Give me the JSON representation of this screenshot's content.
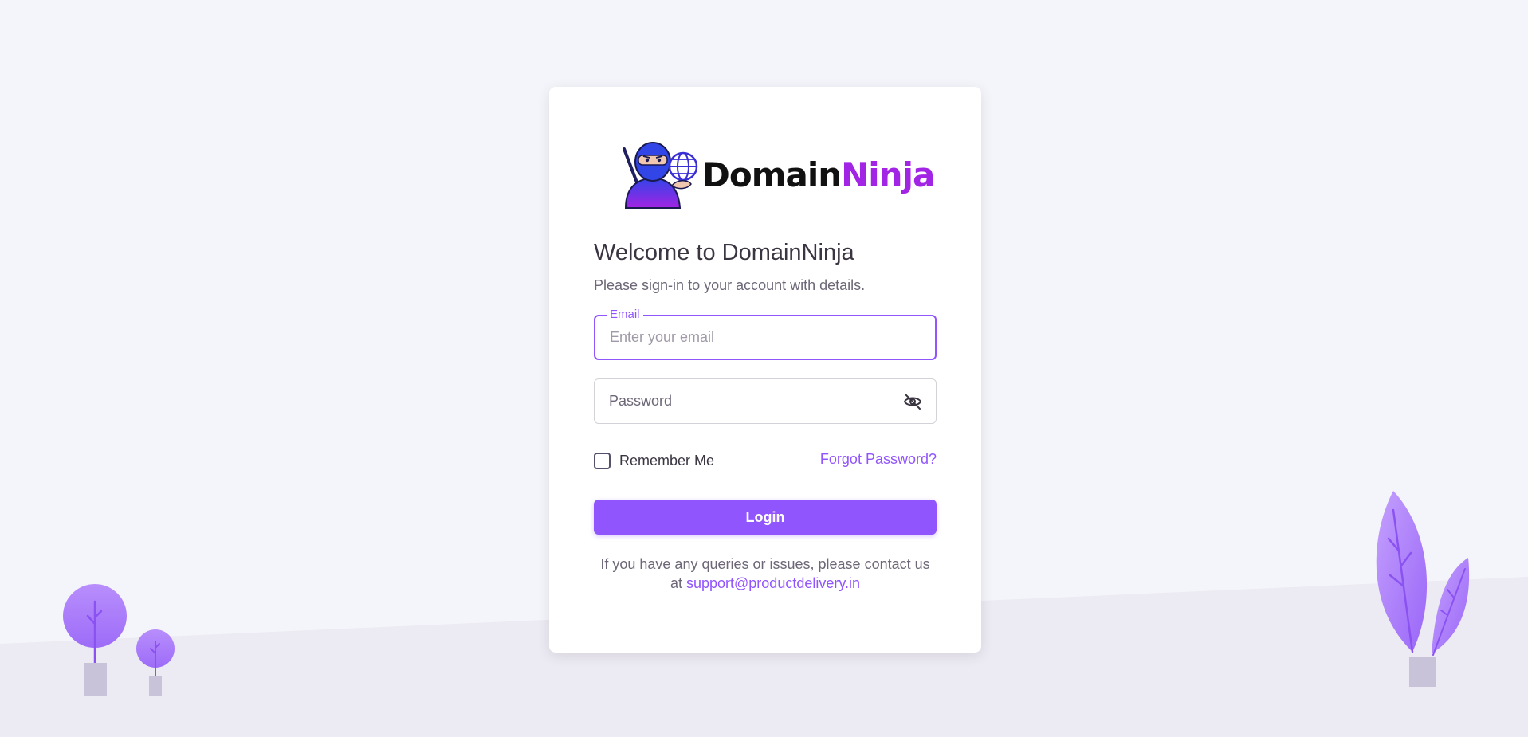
{
  "brand": {
    "name_part1": "Domain",
    "name_part2": "Ninja"
  },
  "login": {
    "welcome_title": "Welcome to DomainNinja",
    "subtitle": "Please sign-in to your account with details.",
    "email_label": "Email",
    "email_placeholder": "Enter your email",
    "email_value": "",
    "password_placeholder": "Password",
    "password_value": "",
    "remember_label": "Remember Me",
    "remember_checked": false,
    "forgot_label": "Forgot Password?",
    "login_button": "Login",
    "contact_text": "If you have any queries or issues, please contact us at",
    "contact_email": "support@productdelivery.in"
  },
  "icons": {
    "logo": "ninja-with-globe-icon",
    "password_toggle": "eye-slash-icon"
  },
  "colors": {
    "primary": "#9155fd",
    "background": "#f4f5fa",
    "floor": "#eceaf2",
    "card": "#ffffff",
    "brand_accent": "#a224e4"
  }
}
